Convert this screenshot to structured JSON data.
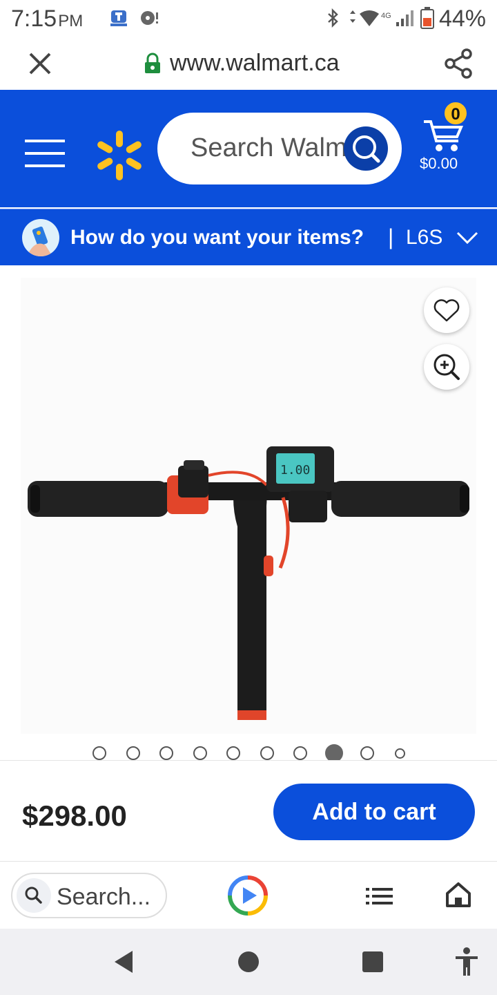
{
  "status_bar": {
    "time": "7:15",
    "ampm": "PM",
    "battery_percent": "44%",
    "network": "4G"
  },
  "browser": {
    "url": "www.walmart.ca",
    "close_icon": "close-icon",
    "share_icon": "share-icon",
    "lock_icon": "lock-icon"
  },
  "header": {
    "search_placeholder": "Search Walmart",
    "cart_count": "0",
    "cart_total": "$0.00",
    "brand_color": "#0b4fdb",
    "spark_color": "#ffc220"
  },
  "delivery": {
    "prompt": "How do you want your items?",
    "separator": "|",
    "postal_code": "L6S"
  },
  "product": {
    "image_alt": "electric scooter handlebar",
    "current_image": 8,
    "total_images": 10,
    "display_reading": "1.00"
  },
  "purchase": {
    "price": "$298.00",
    "add_to_cart_label": "Add to cart"
  },
  "bottom_browser_bar": {
    "search_label": "Search..."
  }
}
